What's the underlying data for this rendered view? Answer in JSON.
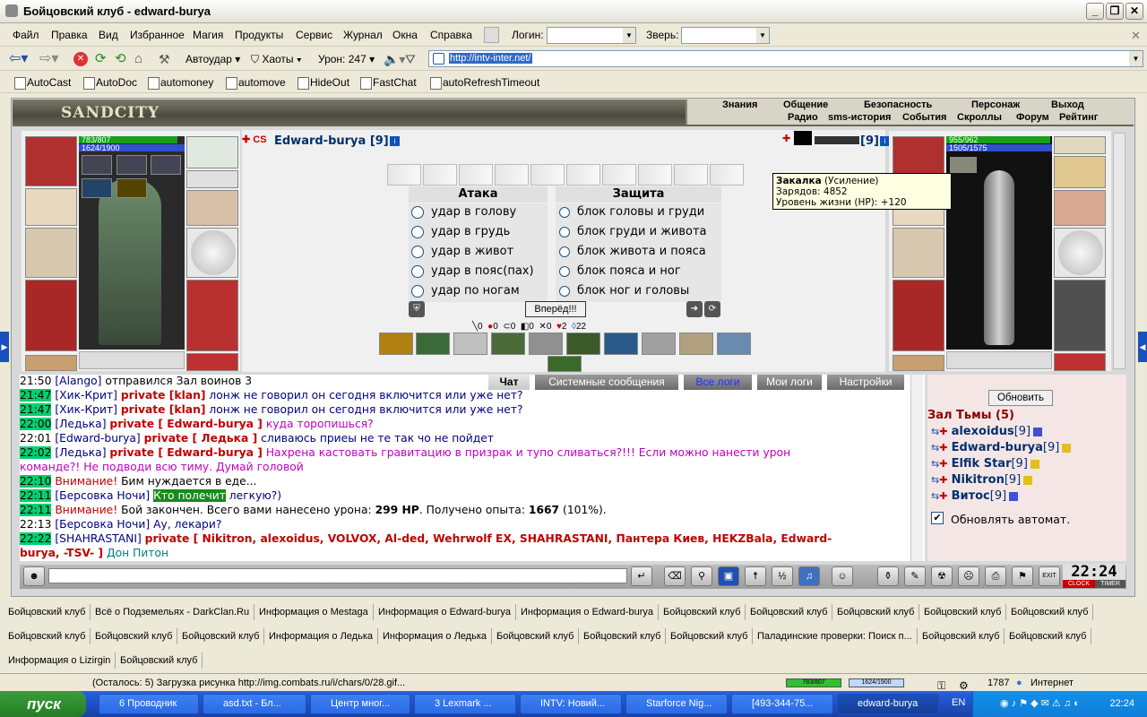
{
  "window": {
    "title": "Бойцовский клуб - edward-burya"
  },
  "menu": {
    "items": [
      "Файл",
      "Правка",
      "Вид",
      "Избранное",
      "Магия",
      "Продукты",
      "Сервис",
      "Журнал",
      "Окна",
      "Справка"
    ],
    "login_label": "Логин:",
    "beast_label": "Зверь:"
  },
  "toolbar": {
    "autoudar": "Автоудар",
    "haoty": "Хаоты",
    "uron": "Урон: 247",
    "url": "http://intv-inter.net/"
  },
  "links": [
    "AutoCast",
    "AutoDoc",
    "automoney",
    "automove",
    "HideOut",
    "FastChat",
    "autoRefreshTimeout"
  ],
  "nav": {
    "top": [
      "Знания",
      "Общение",
      "Безопасность",
      "Персонаж",
      "Выход"
    ],
    "bottom": [
      "Радио",
      "sms-история",
      "События",
      "Скроллы",
      "Форум",
      "Рейтинг"
    ],
    "logo": "SANDCITY"
  },
  "player": {
    "name": "Edward-burya [9]",
    "hp": "783/807",
    "mana": "1624/1900",
    "clan": "CS"
  },
  "enemy": {
    "name": "[9]",
    "hp": "955/962",
    "mana": "1505/1575"
  },
  "tooltip": {
    "title": "Закалка",
    "subtitle": "(Усиление)",
    "line1": "Зарядов: 4852",
    "line2": "Уровень жизни (HP): +120"
  },
  "fight": {
    "attack_title": "Атака",
    "defense_title": "Защита",
    "attacks": [
      "удар в голову",
      "удар в грудь",
      "удар в живот",
      "удар в пояс(пах)",
      "удар по ногам"
    ],
    "defenses": [
      "блок головы и груди",
      "блок груди и живота",
      "блок живота и пояса",
      "блок пояса и ног",
      "блок ног и головы"
    ],
    "go": "Вперёд!!!",
    "stats": [
      "0",
      "0",
      "0",
      "0",
      "0",
      "2",
      "22"
    ]
  },
  "chat_tabs": [
    "Чат",
    "Системные сообщения",
    "Все логи",
    "Мои логи",
    "Настройки"
  ],
  "chat": [
    {
      "time": "21:50",
      "parts": [
        "[Alango]",
        " отправился Зал воинов 3"
      ]
    },
    {
      "time": "21:47",
      "name": "[Хик-Крит]",
      "priv": "private [klan]",
      "msg": "лонж не говорил он сегодня включится или уже нет?"
    },
    {
      "time": "21:47",
      "name": "[Хик-Крит]",
      "priv": "private [klan]",
      "msg": "лонж не говорил он сегодня включится или уже нет?"
    },
    {
      "time": "22:00",
      "name": "[Ледька]",
      "priv": "private [ Edward-burya ]",
      "msg": "куда торопишься?"
    },
    {
      "time": "22:01",
      "name": "[Edward-burya]",
      "priv": "private [ Ледька ]",
      "msg": "сливаюсь приеы не те так чо не пойдет"
    },
    {
      "time": "22:02",
      "name": "[Ледька]",
      "priv": "private [ Edward-burya ]",
      "msg": "Нахрена кастовать гравитацию в призрак и тупо сливаться?!!! Если можно нанести урон",
      "msg2": "команде?! Не подводи всю тиму. Думай головой"
    },
    {
      "time": "22:10",
      "warn": "Внимание!",
      "msg": "Бим нуждается в еде..."
    },
    {
      "time": "22:11",
      "name": "[Берсовка Ночи]",
      "hl": "Кто полечит",
      "msg": "легкую?)"
    },
    {
      "time": "22:11",
      "warn": "Внимание!",
      "msg": "Бой закончен. Всего вами нанесено урона: ",
      "b1": "299 HP",
      "msg_b": ". Получено опыта: ",
      "b2": "1667",
      "msg_c": " (101%)."
    },
    {
      "time": "22:13",
      "name": "[Берсовка Ночи]",
      "msg": "Ау, лекари?"
    },
    {
      "time": "22:22",
      "name": "[SHAHRASTANI]",
      "priv": "private [ Nikitron, alexoidus, VOLVOX, Al-ded, Wehrwolf EX, SHAHRASTANI, Пантера Киев, HEKZBala, Edward-",
      "priv2": "burya, -TSV- ]",
      "msg": "Дон Питон"
    }
  ],
  "userlist": {
    "refresh": "Обновить",
    "room": "Зал Тьмы (5)",
    "users": [
      {
        "name": "alexoidus",
        "lvl": "[9]"
      },
      {
        "name": "Edward-burya",
        "lvl": "[9]"
      },
      {
        "name": "Elfik Star",
        "lvl": "[9]"
      },
      {
        "name": "Nikitron",
        "lvl": "[9]"
      },
      {
        "name": "Витос",
        "lvl": "[9]"
      }
    ],
    "auto": "Обновлять автомат."
  },
  "clock": {
    "time": "22:24",
    "clock_label": "CLOCK",
    "timer_label": "TIMER"
  },
  "tabs_row1": [
    "Бойцовский клуб",
    "Всё о Подземельях - DarkClan.Ru",
    "Информация о Mestaga",
    "Информация о Edward-burya",
    "Информация о Edward-burya",
    "Бойцовский клуб",
    "Бойцовский клуб",
    "Бойцовский клуб",
    "Бойцовский клуб",
    "Бойцовский клуб"
  ],
  "tabs_row2": [
    "Бойцовский клуб",
    "Бойцовский клуб",
    "Бойцовский клуб",
    "Информация о Ледька",
    "Информация о Ледька",
    "Бойцовский клуб",
    "Бойцовский клуб",
    "Бойцовский клуб",
    "Паладинские проверки: Поиск п...",
    "Бойцовский клуб",
    "Бойцовский клуб"
  ],
  "tabs_row3": [
    "Информация о Lizirgin",
    "Бойцовский клуб"
  ],
  "status": {
    "text": "(Осталось: 5) Загрузка рисунка http://img.combats.ru/i/chars/0/28.gif...",
    "hp": "783/807",
    "mana": "1624/1900",
    "num": "1787",
    "zone": "Интернет"
  },
  "taskbar": {
    "start": "пуск",
    "items": [
      "6 Проводник",
      "asd.txt - Бл...",
      "Центр мног...",
      "3 Lexmark ...",
      "INTV: Новий...",
      "Starforce Nig...",
      "[493-344-75...",
      "edward-burya"
    ],
    "lang": "EN",
    "time": "22:24"
  }
}
